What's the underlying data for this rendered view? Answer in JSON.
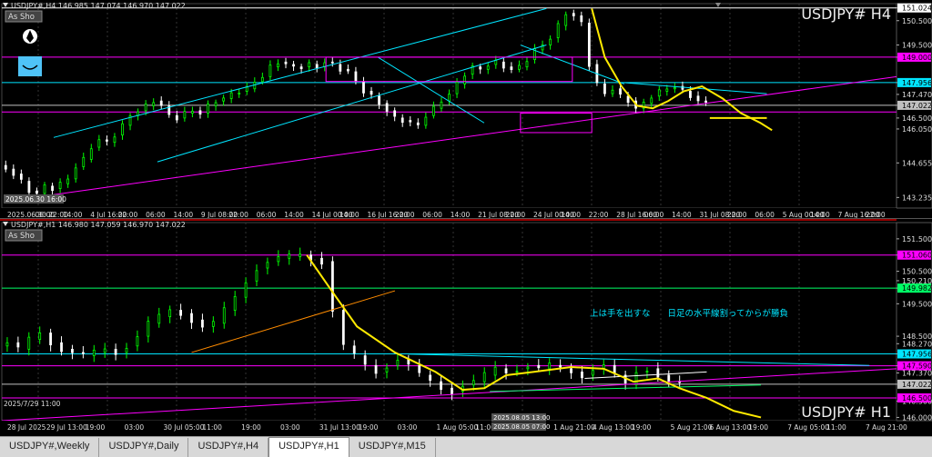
{
  "chart_data": [
    {
      "type": "candlestick",
      "symbol_label": "USDJPY#",
      "timeframe": "H4",
      "header": "USDJPY#,H4  146.985 147.074 146.970 147.022",
      "title": "USDJPY#  H4",
      "ylim": [
        142.8,
        151.2
      ],
      "price_ticks": [
        "151.024",
        "150.500",
        "149.500",
        "149.000",
        "147.956",
        "147.470",
        "147.022",
        "146.500",
        "146.050",
        "144.655",
        "143.235"
      ],
      "time_ticks": [
        "2025.06.30 22:00",
        "06:00",
        "14:00",
        "4 Jul 16:00",
        "22:00",
        "06:00",
        "14:00",
        "9 Jul 08:00",
        "22:00",
        "06:00",
        "14:00",
        "14 Jul 00:00",
        "14:00",
        "16 Jul 16:00",
        "22:00",
        "06:00",
        "14:00",
        "21 Jul 08:00",
        "22:00",
        "24 Jul 00:00",
        "14:00",
        "22:00",
        "28 Jul 16:00",
        "06:00",
        "14:00",
        "31 Jul 08:00",
        "22:00",
        "06:00",
        "5 Aug 00:00",
        "14:00",
        "7 Aug 16:00",
        "22:00"
      ],
      "overlay_label": "2025.06.30 16:00",
      "button_label": "As Sho",
      "hlines": [
        {
          "price": 151.024,
          "color": "#ffffff",
          "label": "151.024"
        },
        {
          "price": 149.0,
          "color": "#ff00ff",
          "label": "149.000"
        },
        {
          "price": 147.956,
          "color": "#00e5ff",
          "label": "147.956"
        },
        {
          "price": 147.022,
          "color": "#c0c0c0",
          "label": "147.022"
        },
        {
          "price": 146.75,
          "color": "#ff00ff",
          "label": ""
        }
      ],
      "close_path": [
        [
          0,
          144.55
        ],
        [
          6,
          144.4
        ],
        [
          12,
          144.2
        ],
        [
          18,
          143.9
        ],
        [
          24,
          143.5
        ],
        [
          30,
          143.4
        ],
        [
          36,
          143.7
        ],
        [
          42,
          143.6
        ],
        [
          48,
          143.8
        ],
        [
          54,
          144.0
        ],
        [
          60,
          144.5
        ],
        [
          66,
          144.8
        ],
        [
          72,
          145.3
        ],
        [
          78,
          145.6
        ],
        [
          84,
          145.5
        ],
        [
          90,
          145.8
        ],
        [
          96,
          146.2
        ],
        [
          102,
          146.6
        ],
        [
          108,
          146.8
        ],
        [
          114,
          147.0
        ],
        [
          120,
          147.2
        ],
        [
          126,
          147.0
        ],
        [
          132,
          146.6
        ],
        [
          138,
          146.5
        ],
        [
          144,
          146.7
        ],
        [
          150,
          146.8
        ],
        [
          156,
          146.7
        ],
        [
          162,
          147.0
        ],
        [
          168,
          147.2
        ],
        [
          174,
          147.3
        ],
        [
          180,
          147.5
        ],
        [
          186,
          147.6
        ],
        [
          192,
          147.7
        ],
        [
          198,
          148.0
        ],
        [
          204,
          148.2
        ],
        [
          210,
          148.6
        ],
        [
          216,
          148.8
        ],
        [
          222,
          148.7
        ],
        [
          228,
          148.6
        ],
        [
          234,
          148.6
        ],
        [
          240,
          148.7
        ],
        [
          246,
          148.6
        ],
        [
          252,
          148.8
        ],
        [
          258,
          148.7
        ],
        [
          264,
          148.5
        ],
        [
          270,
          148.4
        ],
        [
          276,
          148.0
        ],
        [
          282,
          147.6
        ],
        [
          288,
          147.4
        ],
        [
          294,
          147.1
        ],
        [
          300,
          146.8
        ],
        [
          306,
          146.5
        ],
        [
          312,
          146.4
        ],
        [
          318,
          146.3
        ],
        [
          324,
          146.2
        ],
        [
          330,
          146.6
        ],
        [
          336,
          146.9
        ],
        [
          342,
          147.2
        ],
        [
          348,
          147.5
        ],
        [
          354,
          147.9
        ],
        [
          360,
          148.3
        ],
        [
          366,
          148.6
        ],
        [
          372,
          148.5
        ],
        [
          378,
          148.7
        ],
        [
          384,
          148.8
        ],
        [
          390,
          148.6
        ],
        [
          396,
          148.5
        ],
        [
          402,
          148.6
        ],
        [
          408,
          148.9
        ],
        [
          414,
          149.3
        ],
        [
          420,
          149.5
        ],
        [
          426,
          149.8
        ],
        [
          432,
          150.3
        ],
        [
          438,
          150.8
        ],
        [
          444,
          150.7
        ],
        [
          450,
          150.4
        ],
        [
          456,
          148.7
        ],
        [
          462,
          147.9
        ],
        [
          468,
          147.5
        ],
        [
          474,
          147.7
        ],
        [
          480,
          147.4
        ],
        [
          486,
          147.2
        ],
        [
          492,
          146.9
        ],
        [
          498,
          147.1
        ],
        [
          504,
          147.4
        ],
        [
          510,
          147.6
        ],
        [
          516,
          147.7
        ],
        [
          522,
          147.8
        ],
        [
          528,
          147.6
        ],
        [
          534,
          147.4
        ],
        [
          540,
          147.2
        ],
        [
          546,
          147.1
        ]
      ],
      "annotation_lines": [
        {
          "name": "upper-channel",
          "color": "#00e5ff",
          "points": [
            [
              40,
              145.7
            ],
            [
              420,
              151.0
            ]
          ]
        },
        {
          "name": "lower-channel",
          "color": "#00e5ff",
          "points": [
            [
              120,
              144.7
            ],
            [
              420,
              149.5
            ]
          ]
        },
        {
          "name": "cyan-fall-a",
          "color": "#00e5ff",
          "points": [
            [
              290,
              149.0
            ],
            [
              372,
              146.3
            ]
          ]
        },
        {
          "name": "cyan-fall-b",
          "color": "#00e5ff",
          "points": [
            [
              400,
              149.5
            ],
            [
              480,
              147.9
            ]
          ]
        },
        {
          "name": "cyan-flag-top",
          "color": "#00e5ff",
          "points": [
            [
              480,
              147.95
            ],
            [
              590,
              147.5
            ]
          ]
        },
        {
          "name": "magenta-support",
          "color": "#ff00ff",
          "points": [
            [
              40,
              143.35
            ],
            [
              690,
              148.2
            ]
          ]
        },
        {
          "name": "magenta-box-a",
          "color": "#ff00ff",
          "rect": [
            [
              250,
              149.0
            ],
            [
              440,
              148.0
            ]
          ]
        },
        {
          "name": "magenta-box-b",
          "color": "#ff00ff",
          "rect": [
            [
              400,
              146.7
            ],
            [
              455,
              145.9
            ]
          ]
        }
      ],
      "yellow_path": [
        [
          455,
          151.0
        ],
        [
          465,
          149.0
        ],
        [
          478,
          147.8
        ],
        [
          490,
          147.0
        ],
        [
          502,
          146.9
        ],
        [
          514,
          147.2
        ],
        [
          526,
          147.6
        ],
        [
          540,
          147.8
        ],
        [
          556,
          147.3
        ],
        [
          570,
          146.7
        ],
        [
          585,
          146.3
        ],
        [
          594,
          146.0
        ]
      ],
      "yellow_flat": [
        [
          546,
          146.5
        ],
        [
          590,
          146.5
        ]
      ]
    },
    {
      "type": "candlestick",
      "symbol_label": "USDJPY#",
      "timeframe": "H1",
      "header": "USDJPY#,H1  146.980 147.059 146.970 147.022",
      "title": "USDJPY#  H1",
      "ylim": [
        145.9,
        152.0
      ],
      "price_ticks": [
        "151.500",
        "151.000",
        "150.500",
        "150.210",
        "149.982",
        "149.500",
        "148.500",
        "148.270",
        "147.956",
        "147.590",
        "147.370",
        "147.022",
        "146.500",
        "146.000"
      ],
      "time_ticks": [
        "28 Jul 2025",
        "29 Jul 13:00",
        "19:00",
        "03:00",
        "30 Jul 05:00",
        "11:00",
        "19:00",
        "03:00",
        "31 Jul 13:00",
        "19:00",
        "03:00",
        "1 Aug 05:00",
        "11:00",
        "19:00",
        "1 Aug 21:00",
        "4 Aug 13:00",
        "19:00",
        "5 Aug 21:00",
        "6 Aug 13:00",
        "19:00",
        "7 Aug 05:00",
        "11:00",
        "7 Aug 21:00"
      ],
      "overlay_label_a": "2025/7/29 11:00",
      "overlay_label_b": "2025.08.05 13:00",
      "overlay_label_c": "2025.08.05 07:00",
      "button_label": "As Sho",
      "annotation_text": "上は手を出すな　　日足の水平線割ってからが勝負",
      "hlines": [
        {
          "price": 151.0,
          "color": "#ff00ff",
          "label": "151.060"
        },
        {
          "price": 149.982,
          "color": "#00ff66",
          "label": "149.982"
        },
        {
          "price": 147.956,
          "color": "#00e5ff",
          "label": "147.956"
        },
        {
          "price": 147.59,
          "color": "#ff00ff",
          "label": "147.590"
        },
        {
          "price": 147.022,
          "color": "#c0c0c0",
          "label": "147.022"
        },
        {
          "price": 146.6,
          "color": "#ff00ff",
          "label": "146.500"
        }
      ],
      "close_path": [
        [
          0,
          148.2
        ],
        [
          8,
          148.3
        ],
        [
          16,
          148.1
        ],
        [
          24,
          148.4
        ],
        [
          32,
          148.6
        ],
        [
          40,
          148.3
        ],
        [
          48,
          148.1
        ],
        [
          56,
          148.0
        ],
        [
          64,
          147.9
        ],
        [
          72,
          148.0
        ],
        [
          80,
          148.1
        ],
        [
          88,
          148.0
        ],
        [
          96,
          148.2
        ],
        [
          104,
          148.5
        ],
        [
          112,
          148.9
        ],
        [
          120,
          149.1
        ],
        [
          128,
          149.3
        ],
        [
          136,
          149.2
        ],
        [
          144,
          149.0
        ],
        [
          152,
          148.8
        ],
        [
          160,
          148.9
        ],
        [
          168,
          149.3
        ],
        [
          176,
          149.7
        ],
        [
          184,
          150.2
        ],
        [
          192,
          150.6
        ],
        [
          200,
          150.8
        ],
        [
          208,
          150.9
        ],
        [
          216,
          150.95
        ],
        [
          224,
          151.0
        ],
        [
          232,
          150.9
        ],
        [
          240,
          150.8
        ],
        [
          248,
          149.3
        ],
        [
          256,
          148.2
        ],
        [
          264,
          147.9
        ],
        [
          272,
          147.6
        ],
        [
          280,
          147.4
        ],
        [
          288,
          147.6
        ],
        [
          296,
          147.8
        ],
        [
          304,
          147.6
        ],
        [
          312,
          147.3
        ],
        [
          320,
          147.1
        ],
        [
          328,
          146.9
        ],
        [
          336,
          146.8
        ],
        [
          344,
          147.0
        ],
        [
          352,
          147.1
        ],
        [
          360,
          147.3
        ],
        [
          368,
          147.5
        ],
        [
          376,
          147.4
        ],
        [
          384,
          147.5
        ],
        [
          392,
          147.6
        ],
        [
          400,
          147.5
        ],
        [
          408,
          147.6
        ],
        [
          416,
          147.5
        ],
        [
          424,
          147.4
        ],
        [
          432,
          147.3
        ],
        [
          440,
          147.5
        ],
        [
          448,
          147.6
        ],
        [
          456,
          147.3
        ],
        [
          464,
          147.0
        ],
        [
          472,
          147.4
        ],
        [
          480,
          147.5
        ],
        [
          488,
          147.3
        ],
        [
          496,
          147.1
        ],
        [
          504,
          147.0
        ]
      ],
      "annotation_lines": [
        {
          "name": "orange-trend",
          "color": "#ff8c00",
          "points": [
            [
              140,
              148.0
            ],
            [
              290,
              149.9
            ]
          ]
        },
        {
          "name": "cyan-top",
          "color": "#00e5ff",
          "points": [
            [
              300,
              147.95
            ],
            [
              640,
              147.6
            ]
          ]
        },
        {
          "name": "magenta-rise",
          "color": "#ff00ff",
          "points": [
            [
              0,
              145.9
            ],
            [
              660,
              147.5
            ]
          ]
        },
        {
          "name": "green-base",
          "color": "#00ff66",
          "points": [
            [
              360,
              146.8
            ],
            [
              560,
              147.0
            ]
          ]
        },
        {
          "name": "white-flag",
          "color": "#ffffff",
          "points": [
            [
              430,
              147.2
            ],
            [
              520,
              147.4
            ]
          ]
        }
      ],
      "yellow_path": [
        [
          225,
          151.0
        ],
        [
          245,
          149.8
        ],
        [
          262,
          148.8
        ],
        [
          290,
          148.0
        ],
        [
          320,
          147.4
        ],
        [
          340,
          146.85
        ],
        [
          356,
          146.9
        ],
        [
          372,
          147.3
        ],
        [
          392,
          147.4
        ],
        [
          420,
          147.55
        ],
        [
          444,
          147.5
        ],
        [
          466,
          147.1
        ],
        [
          484,
          147.2
        ],
        [
          500,
          146.9
        ],
        [
          520,
          146.6
        ],
        [
          540,
          146.2
        ],
        [
          560,
          146.0
        ]
      ]
    }
  ],
  "tabs": [
    "USDJPY#,Weekly",
    "USDJPY#,Daily",
    "USDJPY#,H4",
    "USDJPY#,H1",
    "USDJPY#,M15"
  ],
  "active_tab": "USDJPY#,H1",
  "colors": {
    "background": "#000000",
    "bull": "#00ff00",
    "bear": "#ffffff",
    "accent": "#ffd700"
  }
}
